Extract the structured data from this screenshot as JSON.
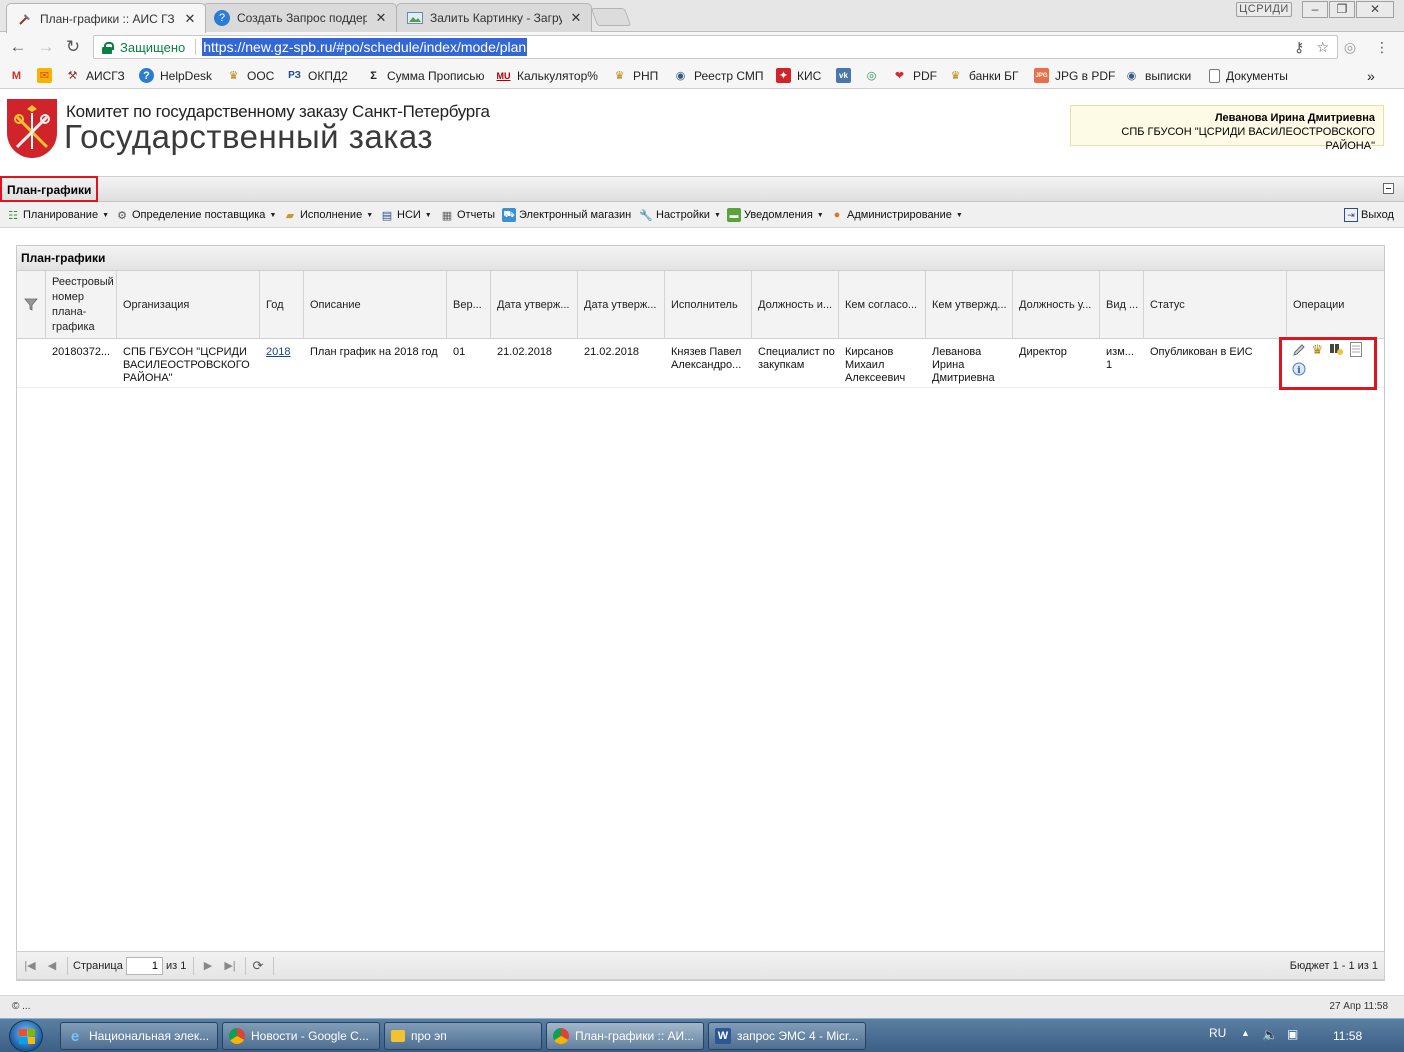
{
  "browser": {
    "tabs": [
      {
        "title": "План-графики :: АИС ГЗ",
        "active": true
      },
      {
        "title": "Создать Запрос поддер",
        "active": false
      },
      {
        "title": "Залить Картинку - Загру",
        "active": false
      }
    ],
    "window_user": "ЦСРИДИ",
    "secure_label": "Защищено",
    "url": "https://new.gz-spb.ru/#po/schedule/index/mode/plan",
    "bookmarks": [
      "АИСГЗ",
      "HelpDesk",
      "ООС",
      "ОКПД2",
      "Сумма Прописью",
      "Калькулятор%",
      "РНП",
      "Реестр СМП",
      "КИС",
      "PDF",
      "банки БГ",
      "JPG в PDF",
      "выписки",
      "Документы"
    ],
    "more_bookmarks": "»"
  },
  "header": {
    "org_title": "Комитет по государственному заказу Санкт-Петербурга",
    "app_title": "Государственный заказ",
    "user_name": "Леванова Ирина Дмитриевна",
    "user_org": "СПБ ГБУСОН \"ЦСРИДИ ВАСИЛЕОСТРОВСКОГО РАЙОНА\""
  },
  "panel": {
    "title": "План-графики"
  },
  "menu": {
    "items": [
      "Планирование",
      "Определение поставщика",
      "Исполнение",
      "НСИ",
      "Отчеты",
      "Электронный магазин",
      "Настройки",
      "Уведомления",
      "Администрирование"
    ],
    "exit": "Выход"
  },
  "grid": {
    "title": "План-графики",
    "columns": [
      "Реестровый\nномер\nплана-\nграфика",
      "Организация",
      "Год",
      "Описание",
      "Вер...",
      "Дата утверж...",
      "Дата утверж...",
      "Исполнитель",
      "Должность и...",
      "Кем согласо...",
      "Кем утвержд...",
      "Должность у...",
      "Вид ...",
      "Статус",
      "Операции"
    ],
    "rows": [
      {
        "reg_number": "20180372...",
        "organization": "СПБ ГБУСОН \"ЦСРИДИ ВАСИЛЕОСТРОВСКОГО РАЙОНА\"",
        "year": "2018",
        "description": "План график на 2018 год",
        "version": "01",
        "date1": "21.02.2018",
        "date2": "21.02.2018",
        "executor": "Князев Павел Александро...",
        "executor_position": "Специалист по закупкам",
        "agreed_by": "Кирсанов Михаил Алексеевич",
        "approved_by": "Леванова Ирина Дмитриевна",
        "approver_position": "Директор",
        "kind": "изм... 1",
        "status": "Опубликован в ЕИС",
        "operations": [
          "edit-icon",
          "coat-of-arms-icon",
          "signature-icon",
          "document-icon",
          "info-icon"
        ]
      }
    ]
  },
  "pager": {
    "page_label": "Страница",
    "page_value": "1",
    "of_label": "из 1",
    "summary": "Бюджет 1 - 1 из 1"
  },
  "footer": {
    "copyright": "© ...",
    "datetime": "27 Апр 11:58"
  },
  "taskbar": {
    "items": [
      "Национальная элек...",
      "Новости - Google C...",
      "про эп",
      "План-графики :: АИ...",
      "запрос ЭМС 4 - Micr..."
    ],
    "lang": "RU",
    "time": "11:58"
  },
  "colors": {
    "highlight": "#e0141e",
    "accent_blue": "#3367d6",
    "secure_green": "#0b8043"
  }
}
